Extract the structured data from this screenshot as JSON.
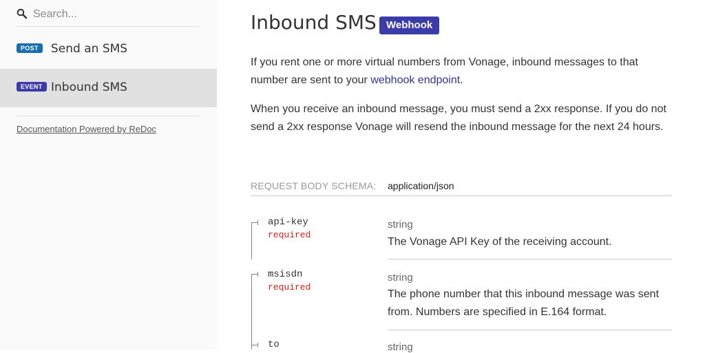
{
  "search": {
    "placeholder": "Search..."
  },
  "sidebar": {
    "items": [
      {
        "badge": "POST",
        "label": "Send an SMS",
        "badge_color": "#186fae",
        "active": false
      },
      {
        "badge": "EVENT",
        "label": "Inbound SMS",
        "badge_color": "#3b3baa",
        "active": true
      }
    ],
    "powered_by": "Documentation Powered by ReDoc"
  },
  "main": {
    "title": "Inbound SMS",
    "badge": "Webhook",
    "intro_before_link": "If you rent one or more virtual numbers from Vonage, inbound messages to that number are sent to your ",
    "intro_link": "webhook endpoint",
    "intro_after_link": ".",
    "response_note": "When you receive an inbound message, you must send a 2xx response. If you do not send a 2xx response Vonage will resend the inbound message for the next 24 hours.",
    "schema_label": "REQUEST BODY SCHEMA:",
    "schema_type": "application/json",
    "properties": [
      {
        "name": "api-key",
        "required": "required",
        "type": "string",
        "description": "The Vonage API Key of the receiving account."
      },
      {
        "name": "msisdn",
        "required": "required",
        "type": "string",
        "description": "The phone number that this inbound message was sent from. Numbers are specified in E.164 format."
      },
      {
        "name": "to",
        "type": "string"
      }
    ]
  },
  "colors": {
    "link": "#32329f",
    "required": "#d41f1c",
    "tree": "#7c7cbb"
  }
}
